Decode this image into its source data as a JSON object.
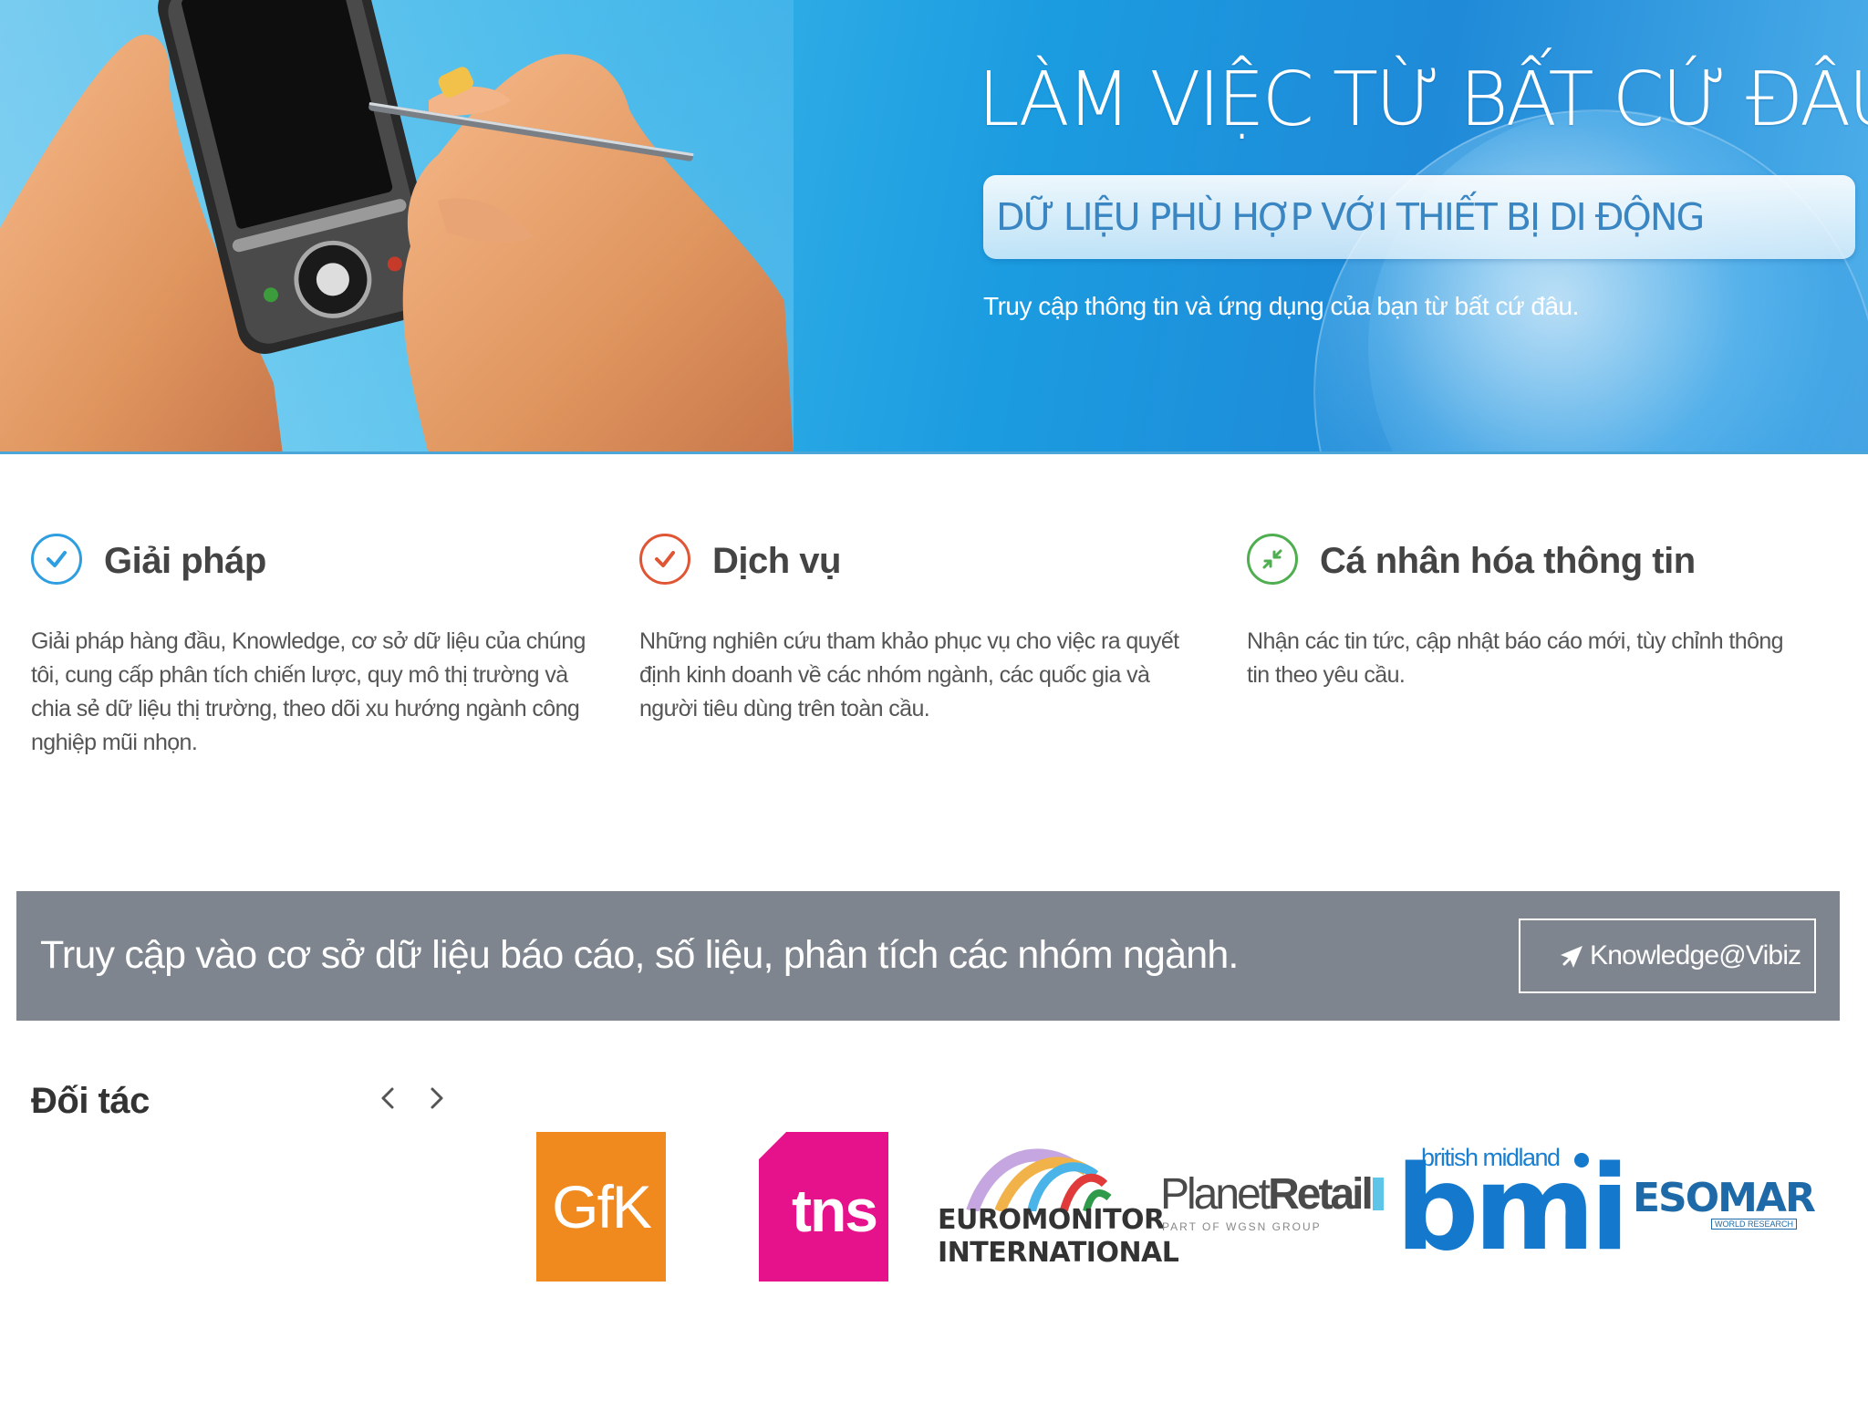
{
  "hero": {
    "title": "LÀM VIỆC TỪ BẤT CỨ ĐÂU",
    "pill_text": "DỮ LIỆU PHÙ HỢP VỚI THIẾT BỊ DI ĐỘNG",
    "subtitle": "Truy cập thông tin và ứng dụng của bạn từ bất cứ đâu."
  },
  "features": [
    {
      "icon": "check-circle-icon",
      "title": "Giải pháp",
      "text": "Giải pháp hàng đầu, Knowledge, cơ sở dữ liệu của chúng tôi, cung cấp phân tích chiến lược, quy mô thị trường và chia sẻ dữ liệu thị trường, theo dõi xu hướng ngành công nghiệp mũi nhọn."
    },
    {
      "icon": "check-circle-icon",
      "title": "Dịch vụ",
      "text": "Những nghiên cứu tham khảo phục vụ cho việc ra quyết định kinh doanh về các nhóm ngành, các quốc gia và người tiêu dùng trên toàn cầu."
    },
    {
      "icon": "compress-arrows-icon",
      "title": "Cá nhân hóa thông tin",
      "text": "Nhận các tin tức, cập nhật báo cáo mới, tùy chỉnh thông tin theo yêu cầu."
    }
  ],
  "cta": {
    "text": "Truy cập vào cơ sở dữ liệu báo cáo, số liệu, phân tích các nhóm ngành.",
    "button_label": "Knowledge@Vibiz",
    "button_icon": "rocket-icon"
  },
  "partners": {
    "title": "Đối tác",
    "prev_icon": "chevron-left-icon",
    "next_icon": "chevron-right-icon",
    "logos": [
      {
        "name": "GfK",
        "text": "GfK",
        "color": "#f08a1e"
      },
      {
        "name": "tns",
        "text": "tns",
        "color": "#e5128c"
      },
      {
        "name": "Euromonitor International",
        "line1": "EUROMONITOR",
        "line2": "INTERNATIONAL"
      },
      {
        "name": "Planet Retail",
        "text_light": "Planet",
        "text_bold": "Retail",
        "tagline": "PART OF WGSN GROUP"
      },
      {
        "name": "bmi",
        "small": "british midland",
        "text": "bmi",
        "color": "#1478cc"
      },
      {
        "name": "ESOMAR",
        "text": "ESOMAR",
        "tagline": "WORLD RESEARCH",
        "color": "#1e6aa8"
      }
    ]
  },
  "colors": {
    "hero_blue": "#1b9be0",
    "cta_gray": "#7e858e",
    "feature_icon_1": "#2e9ee0",
    "feature_icon_2": "#e05533",
    "feature_icon_3": "#4fae4f"
  }
}
